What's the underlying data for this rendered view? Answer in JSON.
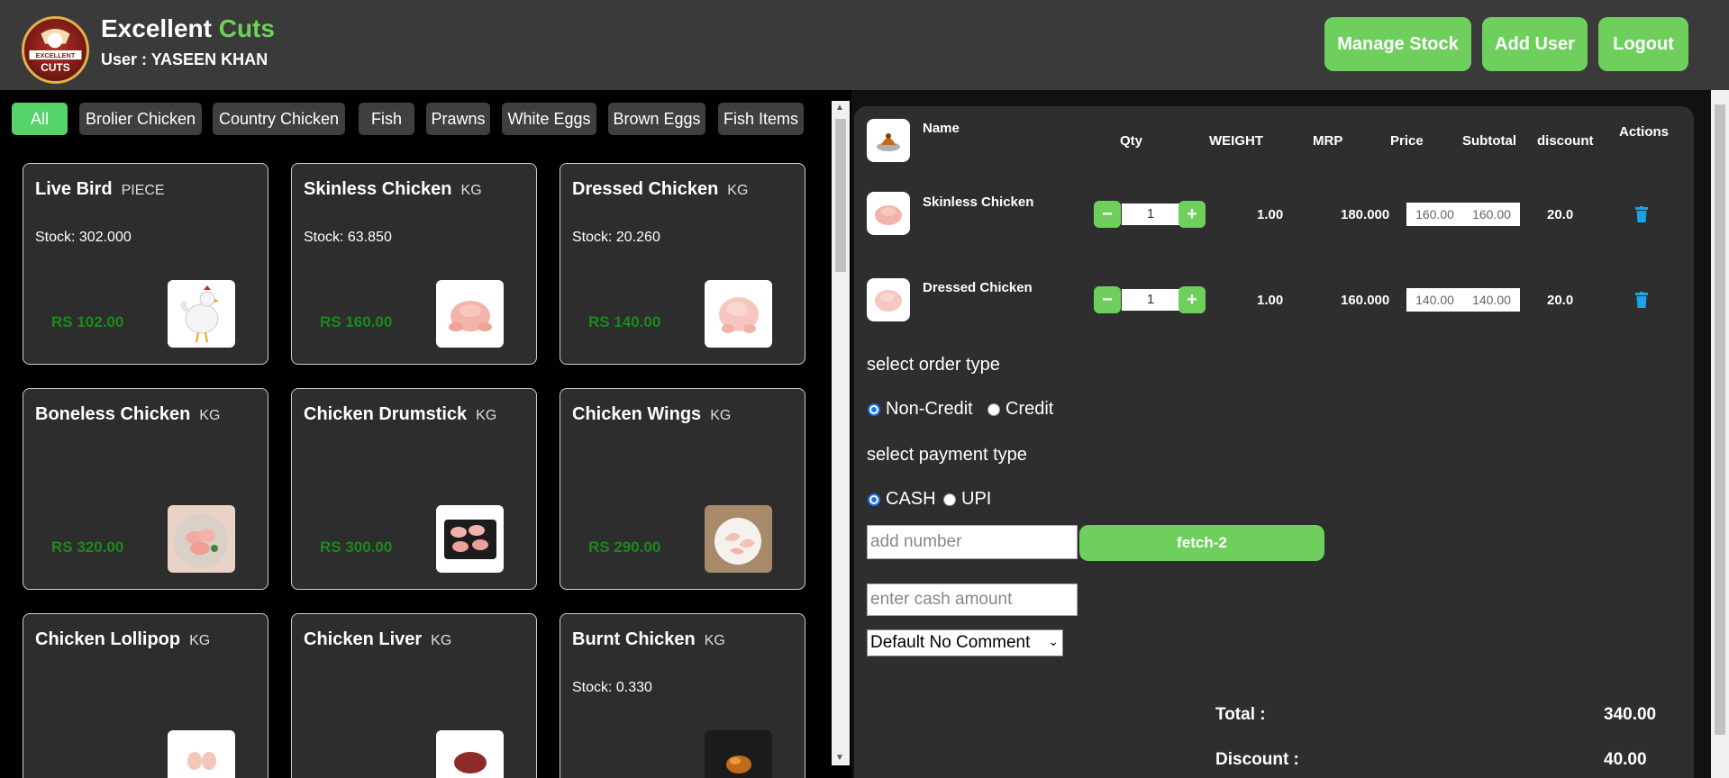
{
  "header": {
    "brand_main": "Excellent",
    "brand_accent": "Cuts",
    "user_line": "User : YASEEN KHAN",
    "logo_text": [
      "EXCELLENT",
      "CUTS"
    ],
    "buttons": {
      "manage_stock": "Manage Stock",
      "add_user": "Add User",
      "logout": "Logout"
    }
  },
  "categories": [
    "All",
    "Brolier Chicken",
    "Country Chicken",
    "Fish",
    "Prawns",
    "White Eggs",
    "Brown Eggs",
    "Fish Items"
  ],
  "products": [
    {
      "name": "Live Bird",
      "unit": "PIECE",
      "stock": "Stock: 302.000",
      "price": "RS 102.00",
      "icon": "rooster-image"
    },
    {
      "name": "Skinless Chicken",
      "unit": "KG",
      "stock": "Stock: 63.850",
      "price": "RS 160.00",
      "icon": "skinless-chicken-image"
    },
    {
      "name": "Dressed Chicken",
      "unit": "KG",
      "stock": "Stock: 20.260",
      "price": "RS 140.00",
      "icon": "dressed-chicken-image"
    },
    {
      "name": "Boneless Chicken",
      "unit": "KG",
      "stock": "",
      "price": "RS 320.00",
      "icon": "boneless-chicken-image"
    },
    {
      "name": "Chicken Drumstick",
      "unit": "KG",
      "stock": "",
      "price": "RS 300.00",
      "icon": "drumstick-image"
    },
    {
      "name": "Chicken Wings",
      "unit": "KG",
      "stock": "",
      "price": "RS 290.00",
      "icon": "wings-image"
    },
    {
      "name": "Chicken Lollipop",
      "unit": "KG",
      "stock": "",
      "price": "",
      "icon": "lollipop-image"
    },
    {
      "name": "Chicken Liver",
      "unit": "KG",
      "stock": "",
      "price": "",
      "icon": "liver-image"
    },
    {
      "name": "Burnt Chicken",
      "unit": "KG",
      "stock": "Stock: 0.330",
      "price": "",
      "icon": "burnt-chicken-image"
    }
  ],
  "cart": {
    "headers": {
      "name": "Name",
      "qty": "Qty",
      "weight": "WEIGHT",
      "mrp": "MRP",
      "price": "Price",
      "subtotal": "Subtotal",
      "discount": "discount",
      "actions": "Actions"
    },
    "rows": [
      {
        "name": "Skinless Chicken",
        "qty": "1",
        "weight": "1.00",
        "mrp": "180.000",
        "price": "160.00",
        "subtotal": "160.00",
        "discount": "20.0"
      },
      {
        "name": "Dressed Chicken",
        "qty": "1",
        "weight": "1.00",
        "mrp": "160.000",
        "price": "140.00",
        "subtotal": "140.00",
        "discount": "20.0"
      }
    ]
  },
  "order": {
    "order_type_label": "select order type",
    "order_types": [
      "Non-Credit",
      "Credit"
    ],
    "payment_type_label": "select payment type",
    "payment_types": [
      "CASH",
      "UPI"
    ],
    "number_placeholder": "add number",
    "fetch_label": "fetch-2",
    "cash_placeholder": "enter cash amount",
    "comment_selected": "Default No Comment",
    "total_label": "Total :",
    "total_value": "340.00",
    "discount_label": "Discount :",
    "discount_value": "40.00"
  },
  "colors": {
    "accent_green": "#6ecf5d",
    "price_green": "#1a8a1a",
    "trash_blue": "#1aa3e8"
  }
}
